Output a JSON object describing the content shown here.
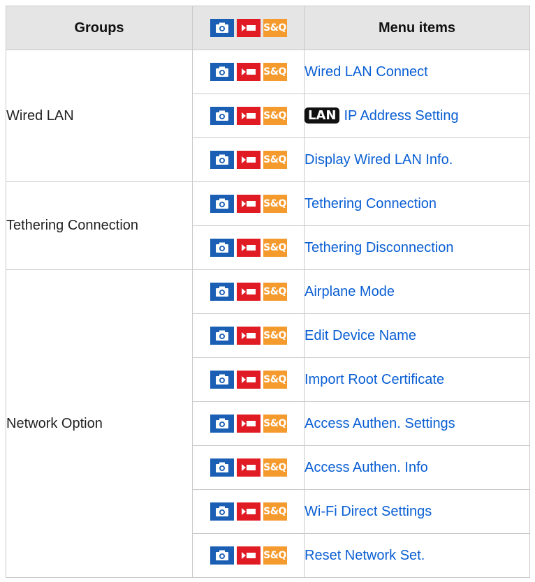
{
  "header": {
    "groups": "Groups",
    "menu_items": "Menu items",
    "modes": [
      "photo-mode-icon",
      "movie-mode-icon",
      "sq-mode-icon"
    ]
  },
  "mode_icons": {
    "photo": "camera-icon",
    "movie": "movie-icon",
    "sq": "S&Q"
  },
  "colors": {
    "photo": "#1a5fb4",
    "movie": "#e01b24",
    "sq": "#f59a2c",
    "link": "#0a5fd4",
    "header_bg": "#e5e5e5"
  },
  "groups": [
    {
      "name": "Wired LAN",
      "items": [
        {
          "label": "Wired LAN Connect"
        },
        {
          "label": "IP Address Setting",
          "badge": "LAN"
        },
        {
          "label": "Display Wired LAN Info."
        }
      ]
    },
    {
      "name": "Tethering Connection",
      "items": [
        {
          "label": "Tethering Connection"
        },
        {
          "label": "Tethering Disconnection"
        }
      ]
    },
    {
      "name": "Network Option",
      "items": [
        {
          "label": "Airplane Mode"
        },
        {
          "label": "Edit Device Name"
        },
        {
          "label": "Import Root Certificate"
        },
        {
          "label": "Access Authen. Settings"
        },
        {
          "label": "Access Authen. Info"
        },
        {
          "label": "Wi-Fi Direct Settings"
        },
        {
          "label": "Reset Network Set."
        }
      ]
    }
  ]
}
